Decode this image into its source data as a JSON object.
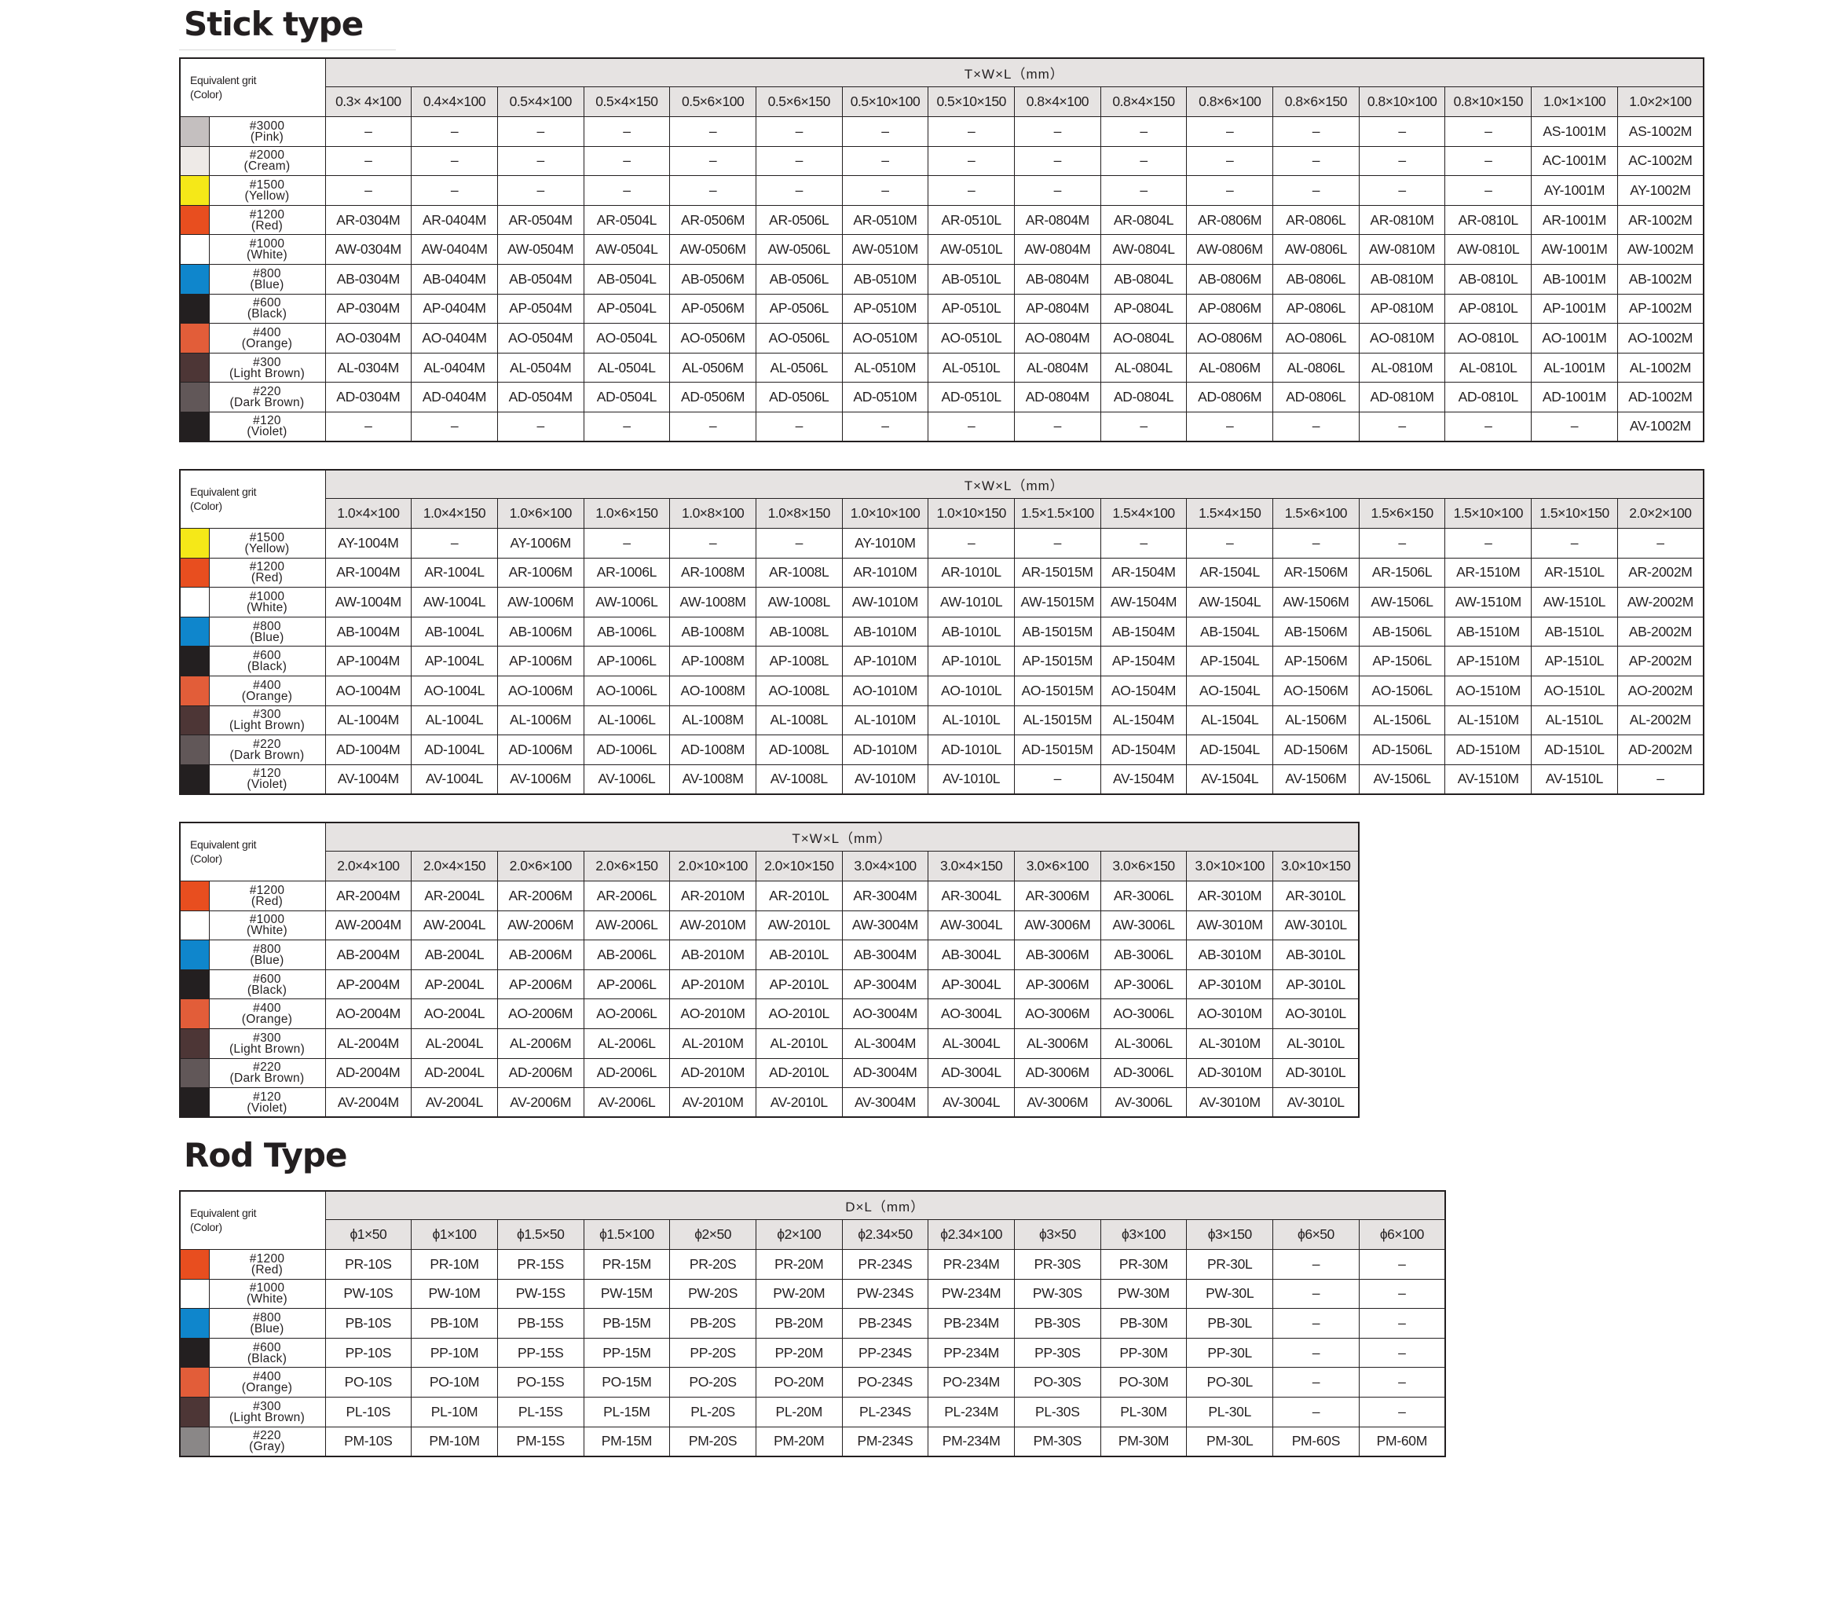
{
  "sections": [
    {
      "title": "Stick type"
    },
    {
      "title": "Rod Type"
    }
  ],
  "tables": [
    {
      "header_label": [
        "Equivalent grit",
        "(Color)"
      ],
      "dim_label": "T×W×L（mm）",
      "columns": [
        "0.3× 4×100",
        "0.4×4×100",
        "0.5×4×100",
        "0.5×4×150",
        "0.5×6×100",
        "0.5×6×150",
        "0.5×10×100",
        "0.5×10×150",
        "0.8×4×100",
        "0.8×4×150",
        "0.8×6×100",
        "0.8×6×150",
        "0.8×10×100",
        "0.8×10×150",
        "1.0×1×100",
        "1.0×2×100"
      ],
      "rows": [
        {
          "grit": "#3000",
          "color_name": "(Pink)",
          "swatch": "#c4bfbf",
          "cells": [
            "–",
            "–",
            "–",
            "–",
            "–",
            "–",
            "–",
            "–",
            "–",
            "–",
            "–",
            "–",
            "–",
            "–",
            "AS-1001M",
            "AS-1002M"
          ]
        },
        {
          "grit": "#2000",
          "color_name": "(Cream)",
          "swatch": "#eeeae7",
          "cells": [
            "–",
            "–",
            "–",
            "–",
            "–",
            "–",
            "–",
            "–",
            "–",
            "–",
            "–",
            "–",
            "–",
            "–",
            "AC-1001M",
            "AC-1002M"
          ]
        },
        {
          "grit": "#1500",
          "color_name": "(Yellow)",
          "swatch": "#f5e818",
          "cells": [
            "–",
            "–",
            "–",
            "–",
            "–",
            "–",
            "–",
            "–",
            "–",
            "–",
            "–",
            "–",
            "–",
            "–",
            "AY-1001M",
            "AY-1002M"
          ]
        },
        {
          "grit": "#1200",
          "color_name": "(Red)",
          "swatch": "#e84e1f",
          "cells": [
            "AR-0304M",
            "AR-0404M",
            "AR-0504M",
            "AR-0504L",
            "AR-0506M",
            "AR-0506L",
            "AR-0510M",
            "AR-0510L",
            "AR-0804M",
            "AR-0804L",
            "AR-0806M",
            "AR-0806L",
            "AR-0810M",
            "AR-0810L",
            "AR-1001M",
            "AR-1002M"
          ]
        },
        {
          "grit": "#1000",
          "color_name": "(White)",
          "swatch": "#ffffff",
          "cells": [
            "AW-0304M",
            "AW-0404M",
            "AW-0504M",
            "AW-0504L",
            "AW-0506M",
            "AW-0506L",
            "AW-0510M",
            "AW-0510L",
            "AW-0804M",
            "AW-0804L",
            "AW-0806M",
            "AW-0806L",
            "AW-0810M",
            "AW-0810L",
            "AW-1001M",
            "AW-1002M"
          ]
        },
        {
          "grit": "#800",
          "color_name": "(Blue)",
          "swatch": "#0f86cc",
          "cells": [
            "AB-0304M",
            "AB-0404M",
            "AB-0504M",
            "AB-0504L",
            "AB-0506M",
            "AB-0506L",
            "AB-0510M",
            "AB-0510L",
            "AB-0804M",
            "AB-0804L",
            "AB-0806M",
            "AB-0806L",
            "AB-0810M",
            "AB-0810L",
            "AB-1001M",
            "AB-1002M"
          ]
        },
        {
          "grit": "#600",
          "color_name": "(Black)",
          "swatch": "#231f20",
          "cells": [
            "AP-0304M",
            "AP-0404M",
            "AP-0504M",
            "AP-0504L",
            "AP-0506M",
            "AP-0506L",
            "AP-0510M",
            "AP-0510L",
            "AP-0804M",
            "AP-0804L",
            "AP-0806M",
            "AP-0806L",
            "AP-0810M",
            "AP-0810L",
            "AP-1001M",
            "AP-1002M"
          ]
        },
        {
          "grit": "#400",
          "color_name": "(Orange)",
          "swatch": "#e25d39",
          "cells": [
            "AO-0304M",
            "AO-0404M",
            "AO-0504M",
            "AO-0504L",
            "AO-0506M",
            "AO-0506L",
            "AO-0510M",
            "AO-0510L",
            "AO-0804M",
            "AO-0804L",
            "AO-0806M",
            "AO-0806L",
            "AO-0810M",
            "AO-0810L",
            "AO-1001M",
            "AO-1002M"
          ]
        },
        {
          "grit": "#300",
          "color_name": "(Light Brown)",
          "swatch": "#4d3636",
          "cells": [
            "AL-0304M",
            "AL-0404M",
            "AL-0504M",
            "AL-0504L",
            "AL-0506M",
            "AL-0506L",
            "AL-0510M",
            "AL-0510L",
            "AL-0804M",
            "AL-0804L",
            "AL-0806M",
            "AL-0806L",
            "AL-0810M",
            "AL-0810L",
            "AL-1001M",
            "AL-1002M"
          ]
        },
        {
          "grit": "#220",
          "color_name": "(Dark Brown)",
          "swatch": "#615758",
          "cells": [
            "AD-0304M",
            "AD-0404M",
            "AD-0504M",
            "AD-0504L",
            "AD-0506M",
            "AD-0506L",
            "AD-0510M",
            "AD-0510L",
            "AD-0804M",
            "AD-0804L",
            "AD-0806M",
            "AD-0806L",
            "AD-0810M",
            "AD-0810L",
            "AD-1001M",
            "AD-1002M"
          ]
        },
        {
          "grit": "#120",
          "color_name": "(Violet)",
          "swatch": "#231f20",
          "cells": [
            "–",
            "–",
            "–",
            "–",
            "–",
            "–",
            "–",
            "–",
            "–",
            "–",
            "–",
            "–",
            "–",
            "–",
            "–",
            "AV-1002M"
          ]
        }
      ]
    },
    {
      "header_label": [
        "Equivalent grit",
        "(Color)"
      ],
      "dim_label": "T×W×L（mm）",
      "columns": [
        "1.0×4×100",
        "1.0×4×150",
        "1.0×6×100",
        "1.0×6×150",
        "1.0×8×100",
        "1.0×8×150",
        "1.0×10×100",
        "1.0×10×150",
        "1.5×1.5×100",
        "1.5×4×100",
        "1.5×4×150",
        "1.5×6×100",
        "1.5×6×150",
        "1.5×10×100",
        "1.5×10×150",
        "2.0×2×100"
      ],
      "rows": [
        {
          "grit": "#1500",
          "color_name": "(Yellow)",
          "swatch": "#f5e818",
          "cells": [
            "AY-1004M",
            "–",
            "AY-1006M",
            "–",
            "–",
            "–",
            "AY-1010M",
            "–",
            "–",
            "–",
            "–",
            "–",
            "–",
            "–",
            "–",
            "–"
          ]
        },
        {
          "grit": "#1200",
          "color_name": "(Red)",
          "swatch": "#e84e1f",
          "cells": [
            "AR-1004M",
            "AR-1004L",
            "AR-1006M",
            "AR-1006L",
            "AR-1008M",
            "AR-1008L",
            "AR-1010M",
            "AR-1010L",
            "AR-15015M",
            "AR-1504M",
            "AR-1504L",
            "AR-1506M",
            "AR-1506L",
            "AR-1510M",
            "AR-1510L",
            "AR-2002M"
          ]
        },
        {
          "grit": "#1000",
          "color_name": "(White)",
          "swatch": "#ffffff",
          "cells": [
            "AW-1004M",
            "AW-1004L",
            "AW-1006M",
            "AW-1006L",
            "AW-1008M",
            "AW-1008L",
            "AW-1010M",
            "AW-1010L",
            "AW-15015M",
            "AW-1504M",
            "AW-1504L",
            "AW-1506M",
            "AW-1506L",
            "AW-1510M",
            "AW-1510L",
            "AW-2002M"
          ]
        },
        {
          "grit": "#800",
          "color_name": "(Blue)",
          "swatch": "#0f86cc",
          "cells": [
            "AB-1004M",
            "AB-1004L",
            "AB-1006M",
            "AB-1006L",
            "AB-1008M",
            "AB-1008L",
            "AB-1010M",
            "AB-1010L",
            "AB-15015M",
            "AB-1504M",
            "AB-1504L",
            "AB-1506M",
            "AB-1506L",
            "AB-1510M",
            "AB-1510L",
            "AB-2002M"
          ]
        },
        {
          "grit": "#600",
          "color_name": "(Black)",
          "swatch": "#231f20",
          "cells": [
            "AP-1004M",
            "AP-1004L",
            "AP-1006M",
            "AP-1006L",
            "AP-1008M",
            "AP-1008L",
            "AP-1010M",
            "AP-1010L",
            "AP-15015M",
            "AP-1504M",
            "AP-1504L",
            "AP-1506M",
            "AP-1506L",
            "AP-1510M",
            "AP-1510L",
            "AP-2002M"
          ]
        },
        {
          "grit": "#400",
          "color_name": "(Orange)",
          "swatch": "#e25d39",
          "cells": [
            "AO-1004M",
            "AO-1004L",
            "AO-1006M",
            "AO-1006L",
            "AO-1008M",
            "AO-1008L",
            "AO-1010M",
            "AO-1010L",
            "AO-15015M",
            "AO-1504M",
            "AO-1504L",
            "AO-1506M",
            "AO-1506L",
            "AO-1510M",
            "AO-1510L",
            "AO-2002M"
          ]
        },
        {
          "grit": "#300",
          "color_name": "(Light Brown)",
          "swatch": "#4d3636",
          "cells": [
            "AL-1004M",
            "AL-1004L",
            "AL-1006M",
            "AL-1006L",
            "AL-1008M",
            "AL-1008L",
            "AL-1010M",
            "AL-1010L",
            "AL-15015M",
            "AL-1504M",
            "AL-1504L",
            "AL-1506M",
            "AL-1506L",
            "AL-1510M",
            "AL-1510L",
            "AL-2002M"
          ]
        },
        {
          "grit": "#220",
          "color_name": "(Dark Brown)",
          "swatch": "#615758",
          "cells": [
            "AD-1004M",
            "AD-1004L",
            "AD-1006M",
            "AD-1006L",
            "AD-1008M",
            "AD-1008L",
            "AD-1010M",
            "AD-1010L",
            "AD-15015M",
            "AD-1504M",
            "AD-1504L",
            "AD-1506M",
            "AD-1506L",
            "AD-1510M",
            "AD-1510L",
            "AD-2002M"
          ]
        },
        {
          "grit": "#120",
          "color_name": "(Violet)",
          "swatch": "#231f20",
          "cells": [
            "AV-1004M",
            "AV-1004L",
            "AV-1006M",
            "AV-1006L",
            "AV-1008M",
            "AV-1008L",
            "AV-1010M",
            "AV-1010L",
            "–",
            "AV-1504M",
            "AV-1504L",
            "AV-1506M",
            "AV-1506L",
            "AV-1510M",
            "AV-1510L",
            "–"
          ]
        }
      ]
    },
    {
      "header_label": [
        "Equivalent grit",
        "(Color)"
      ],
      "dim_label": "T×W×L（mm）",
      "columns": [
        "2.0×4×100",
        "2.0×4×150",
        "2.0×6×100",
        "2.0×6×150",
        "2.0×10×100",
        "2.0×10×150",
        "3.0×4×100",
        "3.0×4×150",
        "3.0×6×100",
        "3.0×6×150",
        "3.0×10×100",
        "3.0×10×150"
      ],
      "rows": [
        {
          "grit": "#1200",
          "color_name": "(Red)",
          "swatch": "#e84e1f",
          "cells": [
            "AR-2004M",
            "AR-2004L",
            "AR-2006M",
            "AR-2006L",
            "AR-2010M",
            "AR-2010L",
            "AR-3004M",
            "AR-3004L",
            "AR-3006M",
            "AR-3006L",
            "AR-3010M",
            "AR-3010L"
          ]
        },
        {
          "grit": "#1000",
          "color_name": "(White)",
          "swatch": "#ffffff",
          "cells": [
            "AW-2004M",
            "AW-2004L",
            "AW-2006M",
            "AW-2006L",
            "AW-2010M",
            "AW-2010L",
            "AW-3004M",
            "AW-3004L",
            "AW-3006M",
            "AW-3006L",
            "AW-3010M",
            "AW-3010L"
          ]
        },
        {
          "grit": "#800",
          "color_name": "(Blue)",
          "swatch": "#0f86cc",
          "cells": [
            "AB-2004M",
            "AB-2004L",
            "AB-2006M",
            "AB-2006L",
            "AB-2010M",
            "AB-2010L",
            "AB-3004M",
            "AB-3004L",
            "AB-3006M",
            "AB-3006L",
            "AB-3010M",
            "AB-3010L"
          ]
        },
        {
          "grit": "#600",
          "color_name": "(Black)",
          "swatch": "#231f20",
          "cells": [
            "AP-2004M",
            "AP-2004L",
            "AP-2006M",
            "AP-2006L",
            "AP-2010M",
            "AP-2010L",
            "AP-3004M",
            "AP-3004L",
            "AP-3006M",
            "AP-3006L",
            "AP-3010M",
            "AP-3010L"
          ]
        },
        {
          "grit": "#400",
          "color_name": "(Orange)",
          "swatch": "#e25d39",
          "cells": [
            "AO-2004M",
            "AO-2004L",
            "AO-2006M",
            "AO-2006L",
            "AO-2010M",
            "AO-2010L",
            "AO-3004M",
            "AO-3004L",
            "AO-3006M",
            "AO-3006L",
            "AO-3010M",
            "AO-3010L"
          ]
        },
        {
          "grit": "#300",
          "color_name": "(Light Brown)",
          "swatch": "#4d3636",
          "cells": [
            "AL-2004M",
            "AL-2004L",
            "AL-2006M",
            "AL-2006L",
            "AL-2010M",
            "AL-2010L",
            "AL-3004M",
            "AL-3004L",
            "AL-3006M",
            "AL-3006L",
            "AL-3010M",
            "AL-3010L"
          ]
        },
        {
          "grit": "#220",
          "color_name": "(Dark Brown)",
          "swatch": "#615758",
          "cells": [
            "AD-2004M",
            "AD-2004L",
            "AD-2006M",
            "AD-2006L",
            "AD-2010M",
            "AD-2010L",
            "AD-3004M",
            "AD-3004L",
            "AD-3006M",
            "AD-3006L",
            "AD-3010M",
            "AD-3010L"
          ]
        },
        {
          "grit": "#120",
          "color_name": "(Violet)",
          "swatch": "#231f20",
          "cells": [
            "AV-2004M",
            "AV-2004L",
            "AV-2006M",
            "AV-2006L",
            "AV-2010M",
            "AV-2010L",
            "AV-3004M",
            "AV-3004L",
            "AV-3006M",
            "AV-3006L",
            "AV-3010M",
            "AV-3010L"
          ]
        }
      ]
    },
    {
      "header_label": [
        "Equivalent grit",
        "(Color)"
      ],
      "dim_label": "D×L（mm）",
      "columns": [
        "ϕ1×50",
        "ϕ1×100",
        "ϕ1.5×50",
        "ϕ1.5×100",
        "ϕ2×50",
        "ϕ2×100",
        "ϕ2.34×50",
        "ϕ2.34×100",
        "ϕ3×50",
        "ϕ3×100",
        "ϕ3×150",
        "ϕ6×50",
        "ϕ6×100"
      ],
      "rows": [
        {
          "grit": "#1200",
          "color_name": "(Red)",
          "swatch": "#e84e1f",
          "cells": [
            "PR-10S",
            "PR-10M",
            "PR-15S",
            "PR-15M",
            "PR-20S",
            "PR-20M",
            "PR-234S",
            "PR-234M",
            "PR-30S",
            "PR-30M",
            "PR-30L",
            "–",
            "–"
          ]
        },
        {
          "grit": "#1000",
          "color_name": "(White)",
          "swatch": "#ffffff",
          "cells": [
            "PW-10S",
            "PW-10M",
            "PW-15S",
            "PW-15M",
            "PW-20S",
            "PW-20M",
            "PW-234S",
            "PW-234M",
            "PW-30S",
            "PW-30M",
            "PW-30L",
            "–",
            "–"
          ]
        },
        {
          "grit": "#800",
          "color_name": "(Blue)",
          "swatch": "#0f86cc",
          "cells": [
            "PB-10S",
            "PB-10M",
            "PB-15S",
            "PB-15M",
            "PB-20S",
            "PB-20M",
            "PB-234S",
            "PB-234M",
            "PB-30S",
            "PB-30M",
            "PB-30L",
            "–",
            "–"
          ]
        },
        {
          "grit": "#600",
          "color_name": "(Black)",
          "swatch": "#231f20",
          "cells": [
            "PP-10S",
            "PP-10M",
            "PP-15S",
            "PP-15M",
            "PP-20S",
            "PP-20M",
            "PP-234S",
            "PP-234M",
            "PP-30S",
            "PP-30M",
            "PP-30L",
            "–",
            "–"
          ]
        },
        {
          "grit": "#400",
          "color_name": "(Orange)",
          "swatch": "#e25d39",
          "cells": [
            "PO-10S",
            "PO-10M",
            "PO-15S",
            "PO-15M",
            "PO-20S",
            "PO-20M",
            "PO-234S",
            "PO-234M",
            "PO-30S",
            "PO-30M",
            "PO-30L",
            "–",
            "–"
          ]
        },
        {
          "grit": "#300",
          "color_name": "(Light Brown)",
          "swatch": "#4d3636",
          "cells": [
            "PL-10S",
            "PL-10M",
            "PL-15S",
            "PL-15M",
            "PL-20S",
            "PL-20M",
            "PL-234S",
            "PL-234M",
            "PL-30S",
            "PL-30M",
            "PL-30L",
            "–",
            "–"
          ]
        },
        {
          "grit": "#220",
          "color_name": "(Gray)",
          "swatch": "#8a8787",
          "cells": [
            "PM-10S",
            "PM-10M",
            "PM-15S",
            "PM-15M",
            "PM-20S",
            "PM-20M",
            "PM-234S",
            "PM-234M",
            "PM-30S",
            "PM-30M",
            "PM-30L",
            "PM-60S",
            "PM-60M"
          ]
        }
      ]
    }
  ]
}
